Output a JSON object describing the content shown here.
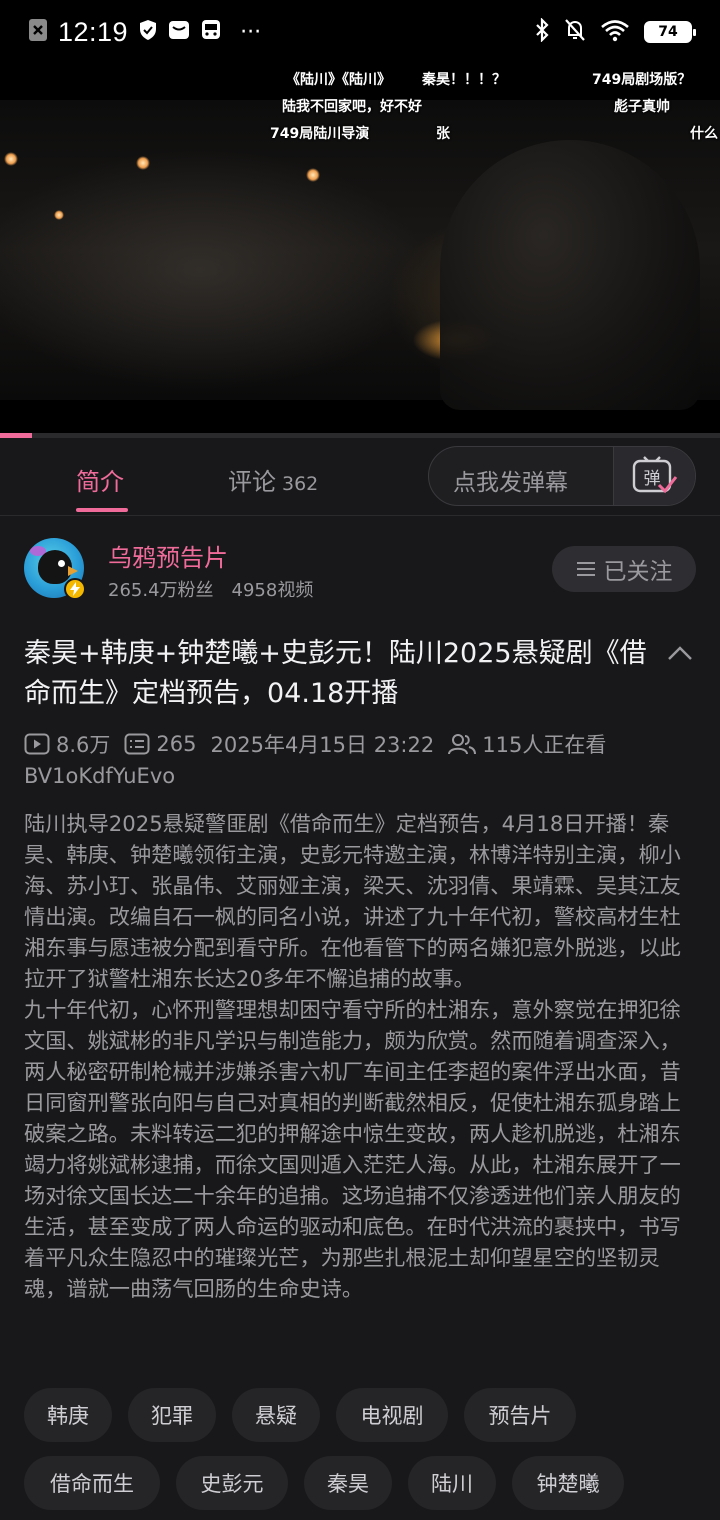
{
  "status_bar": {
    "time": "12:19",
    "battery": "74",
    "icons": [
      "notification-x-icon",
      "shield-icon",
      "message-icon",
      "bus-icon",
      "more-dots-icon",
      "bluetooth-icon",
      "mute-icon",
      "wifi-icon",
      "battery-icon"
    ],
    "more": "···"
  },
  "video": {
    "danmaku": [
      "《陆川》《陆川》",
      "秦昊！！！？",
      "749局剧场版？",
      "陆我不回家吧，好不好",
      "彪子真帅",
      "749局陆川导演",
      "张",
      "什么"
    ],
    "progress": 0.045
  },
  "tabs": {
    "intro": "简介",
    "comments": "评论",
    "comments_count": "362",
    "danmaku_placeholder": "点我发弹幕",
    "danmaku_button": "弹"
  },
  "uploader": {
    "name": "乌鸦预告片",
    "fans": "265.4万粉丝",
    "videos": "4958视频",
    "follow_label": "已关注"
  },
  "video_info": {
    "title": "秦昊+韩庚+钟楚曦+史彭元！陆川2025悬疑剧《借命而生》定档预告，04.18开播",
    "views": "8.6万",
    "danmaku_count": "265",
    "date": "2025年4月15日 23:22",
    "watching": "115人正在看",
    "bvid": "BV1oKdfYuEvo",
    "description": [
      "陆川执导2025悬疑警匪剧《借命而生》定档预告，4月18日开播！秦昊、韩庚、钟楚曦领衔主演，史彭元特邀主演，林博洋特别主演，柳小海、苏小玎、张晶伟、艾丽娅主演，梁天、沈羽倩、果靖霖、吴其江友情出演。改编自石一枫的同名小说，讲述了九十年代初，警校高材生杜湘东事与愿违被分配到看守所。在他看管下的两名嫌犯意外脱逃，以此拉开了狱警杜湘东长达20多年不懈追捕的故事。",
      "九十年代初，心怀刑警理想却困守看守所的杜湘东，意外察觉在押犯徐文国、姚斌彬的非凡学识与制造能力，颇为欣赏。然而随着调查深入，两人秘密研制枪械并涉嫌杀害六机厂车间主任李超的案件浮出水面，昔日同窗刑警张向阳与自己对真相的判断截然相反，促使杜湘东孤身踏上破案之路。未料转运二犯的押解途中惊生变故，两人趁机脱逃，杜湘东竭力将姚斌彬逮捕，而徐文国则遁入茫茫人海。从此，杜湘东展开了一场对徐文国长达二十余年的追捕。这场追捕不仅渗透进他们亲人朋友的生活，甚至变成了两人命运的驱动和底色。在时代洪流的裹挟中，书写着平凡众生隐忍中的璀璨光芒，为那些扎根泥土却仰望星空的坚韧灵魂，谱就一曲荡气回肠的生命史诗。"
    ]
  },
  "tags": [
    "韩庚",
    "犯罪",
    "悬疑",
    "电视剧",
    "预告片",
    "借命而生",
    "史彭元",
    "秦昊",
    "陆川",
    "钟楚曦"
  ],
  "colors": {
    "accent": "#f06b9a",
    "background": "#18181a",
    "muted_text": "#9a9a9e"
  }
}
